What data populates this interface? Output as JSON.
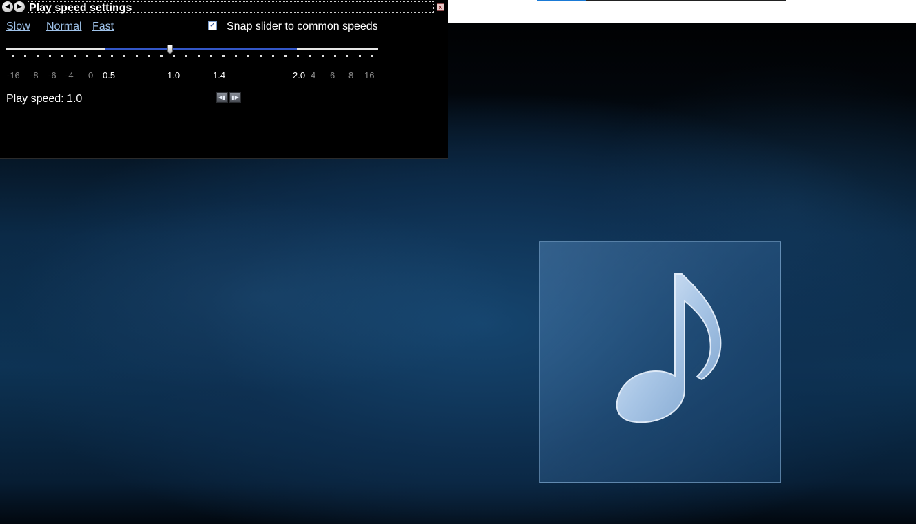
{
  "window": {
    "title": "Play speed settings",
    "close_glyph": "x"
  },
  "presets": {
    "slow": "Slow",
    "normal": "Normal",
    "fast": "Fast"
  },
  "snap": {
    "label": "Snap slider to common speeds",
    "checked": true,
    "check_glyph": "✓"
  },
  "slider": {
    "value": 1.0,
    "range_low": 0.5,
    "range_high": 2.0,
    "labels": {
      "m16": "-16",
      "m8": "-8",
      "m6": "-6",
      "m4": "-4",
      "z": "0",
      "p05": "0.5",
      "p10": "1.0",
      "p14": "1.4",
      "p20": "2.0",
      "p4": "4",
      "p6": "6",
      "p8": "8",
      "p16": "16"
    }
  },
  "status": {
    "text": "Play speed: 1.0"
  },
  "step_buttons": {
    "slower_icon": "step-slower-icon",
    "faster_icon": "step-faster-icon"
  },
  "icons": {
    "back": "back-arrow-icon",
    "forward": "forward-arrow-icon",
    "album": "music-note-icon"
  },
  "colors": {
    "slider_range": "#3457c8",
    "link": "#9fc3ea",
    "panel_bg": "#000000"
  }
}
